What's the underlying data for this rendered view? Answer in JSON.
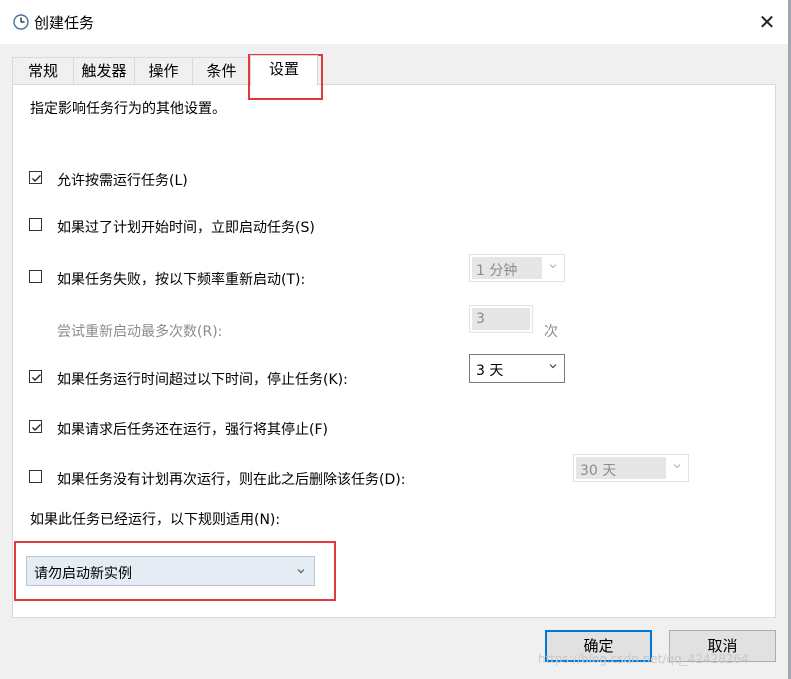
{
  "window": {
    "title": "创建任务",
    "close_glyph": "✕",
    "icon": "clock-icon"
  },
  "tabs": [
    {
      "label": "常规",
      "active": false
    },
    {
      "label": "触发器",
      "active": false
    },
    {
      "label": "操作",
      "active": false
    },
    {
      "label": "条件",
      "active": false
    },
    {
      "label": "设置",
      "active": true
    }
  ],
  "settings": {
    "description": "指定影响任务行为的其他设置。",
    "allow_on_demand": {
      "label": "允许按需运行任务(L)",
      "checked": true
    },
    "start_if_missed": {
      "label": "如果过了计划开始时间，立即启动任务(S)",
      "checked": false
    },
    "restart_on_fail": {
      "label": "如果任务失败，按以下频率重新启动(T):",
      "checked": false,
      "interval": "1 分钟"
    },
    "restart_attempts": {
      "label": "尝试重新启动最多次数(R):",
      "value": "3",
      "unit": "次"
    },
    "stop_if_longer": {
      "label": "如果任务运行时间超过以下时间，停止任务(K):",
      "checked": true,
      "duration": "3 天"
    },
    "force_stop": {
      "label": "如果请求后任务还在运行，强行将其停止(F)",
      "checked": true
    },
    "delete_if_not_scheduled": {
      "label": "如果任务没有计划再次运行，则在此之后删除该任务(D):",
      "checked": false,
      "after": "30 天"
    },
    "rule_label": "如果此任务已经运行，以下规则适用(N):",
    "rule_value": "请勿启动新实例"
  },
  "buttons": {
    "ok": "确定",
    "cancel": "取消"
  },
  "watermark": "https://blog.csdn.net/qq_42428264",
  "colors": {
    "highlight": "#e0393e",
    "default_button_border": "#0078d7"
  }
}
